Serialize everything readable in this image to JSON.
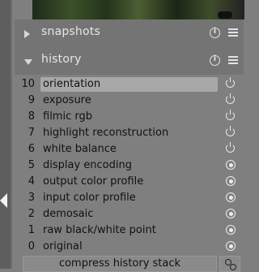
{
  "sections": {
    "snapshots": {
      "title": "snapshots",
      "expanded": false
    },
    "history": {
      "title": "history",
      "expanded": true
    }
  },
  "history": {
    "items": [
      {
        "num": "10",
        "label": "orientation",
        "selected": true,
        "icon": "power-icon"
      },
      {
        "num": "9",
        "label": "exposure",
        "icon": "power-icon"
      },
      {
        "num": "8",
        "label": "filmic rgb",
        "icon": "power-icon"
      },
      {
        "num": "7",
        "label": "highlight reconstruction",
        "icon": "power-icon"
      },
      {
        "num": "6",
        "label": "white balance",
        "icon": "power-icon"
      },
      {
        "num": "5",
        "label": "display encoding",
        "icon": "always-on-icon"
      },
      {
        "num": "4",
        "label": "output color profile",
        "icon": "always-on-icon"
      },
      {
        "num": "3",
        "label": "input color profile",
        "icon": "always-on-icon"
      },
      {
        "num": "2",
        "label": "demosaic",
        "icon": "always-on-icon"
      },
      {
        "num": "1",
        "label": "raw black/white point",
        "icon": "always-on-icon"
      },
      {
        "num": "0",
        "label": "original",
        "icon": "always-on-icon"
      }
    ],
    "compress_label": "compress history stack"
  },
  "colors": {
    "panel_bg": "#7f7f7f",
    "header_bg": "#747474",
    "selected_bg": "#a8a8a8",
    "header_text": "#e6e6e6"
  }
}
